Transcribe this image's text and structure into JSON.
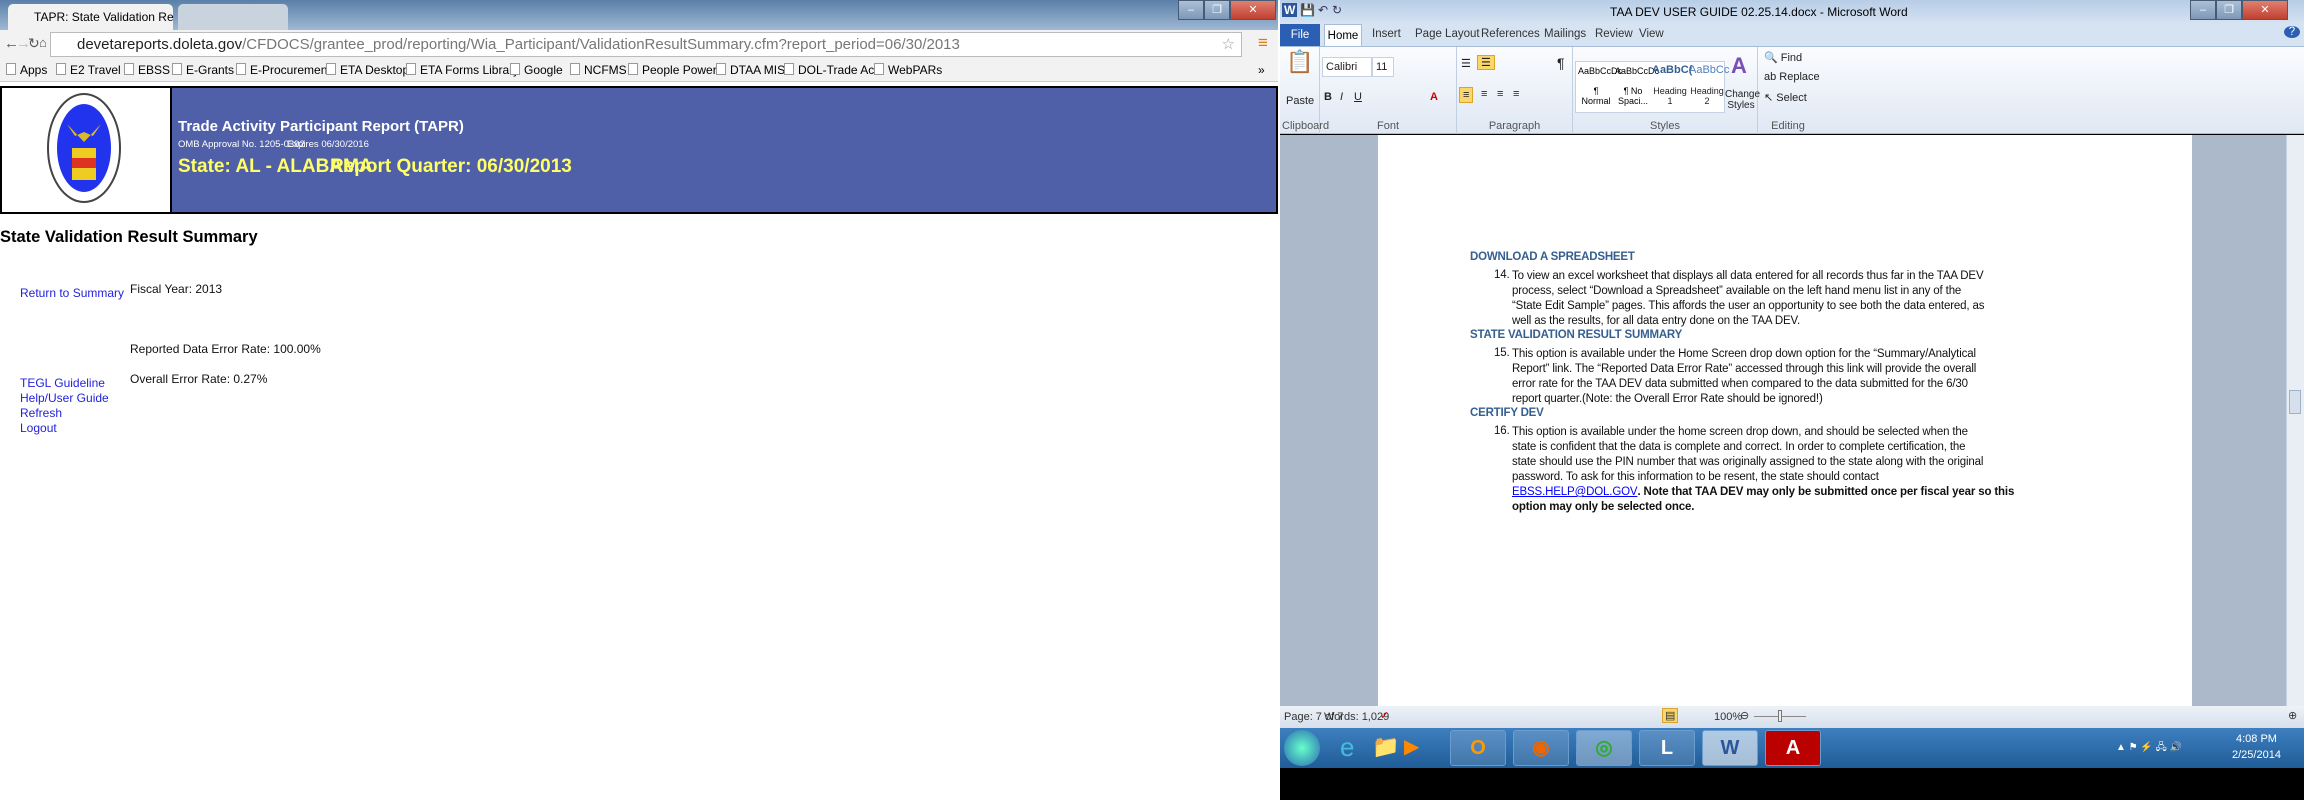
{
  "browser": {
    "tabs": [
      {
        "label": "TAPR: State Validation Res"
      },
      {
        "label": ""
      }
    ],
    "url_host": "devetareports.doleta.gov",
    "url_path": "/CFDOCS/grantee_prod/reporting/Wia_Participant/ValidationResultSummary.cfm?report_period=06/30/2013",
    "bookmarks": [
      "Apps",
      "E2 Travel",
      "EBSS",
      "E-Grants",
      "E-Procurement",
      "ETA Desktop",
      "ETA Forms Library",
      "Google",
      "NCFMS",
      "People Power",
      "DTAA MIS",
      "DOL-Trade Act",
      "WebPARs"
    ],
    "more": "»"
  },
  "page": {
    "title": "Trade Activity Participant Report (TAPR)",
    "omb": "OMB Approval No. 1205-0392",
    "expires": "Expires 06/30/2016",
    "state": "State: AL - ALABAMA",
    "quarter": "Report Quarter: 06/30/2013",
    "heading": "State Validation Result Summary",
    "links": {
      "return": "Return to Summary",
      "tegl": "TEGL Guideline",
      "help": "Help/User Guide",
      "refresh": "Refresh",
      "logout": "Logout"
    },
    "fiscal_year": "Fiscal Year: 2013",
    "reported_rate": "Reported Data Error Rate: 100.00%",
    "overall_rate": "Overall Error Rate: 0.27%"
  },
  "word": {
    "title": "TAA DEV USER GUIDE 02.25.14.docx - Microsoft Word",
    "tabs": [
      "File",
      "Home",
      "Insert",
      "Page Layout",
      "References",
      "Mailings",
      "Review",
      "View"
    ],
    "font": "Calibri",
    "size": "11",
    "paste": "Paste",
    "groups": [
      "Clipboard",
      "Font",
      "Paragraph",
      "Styles",
      "Editing"
    ],
    "styles": [
      {
        "sample": "AaBbCcDc",
        "name": "¶ Normal"
      },
      {
        "sample": "AaBbCcDc",
        "name": "¶ No Spaci..."
      },
      {
        "sample": "AaBbC(",
        "name": "Heading 1"
      },
      {
        "sample": "AaBbCc",
        "name": "Heading 2"
      }
    ],
    "change_styles": "Change Styles",
    "editing": [
      "Find",
      "Replace",
      "Select"
    ],
    "doc": [
      {
        "heading": "DOWNLOAD A SPREADSHEET",
        "num": "14.",
        "lines": [
          "To view an excel worksheet that displays all data entered for all records thus far in the TAA DEV",
          "process, select “Download a Spreadsheet” available on the left hand menu list in any of the",
          "“State Edit Sample” pages.  This affords the user an opportunity to see both the data entered, as",
          "well as the results, for all data entry done on the TAA DEV."
        ]
      },
      {
        "heading": "STATE VALIDATION RESULT SUMMARY",
        "num": "15.",
        "lines": [
          "This option is available under the Home Screen drop down option for the “Summary/Analytical",
          "Report” link. The “Reported Data Error Rate” accessed through this link will provide the overall",
          "error rate for the TAA DEV data submitted when compared to the data submitted for the 6/30",
          "report quarter.(Note: the Overall Error Rate should be ignored!)"
        ]
      },
      {
        "heading": "CERTIFY DEV",
        "num": "16.",
        "lines": [
          "This option is available under the home screen drop down, and should be selected when the",
          "state is confident that the data is complete and correct. In order to complete certification, the",
          "state should use the PIN number that was originally assigned to the state along with the original",
          "password. To ask for this information to be resent, the state should contact"
        ],
        "email": "EBSS.HELP@DOL.GOV",
        "bold1": ". Note that TAA DEV may only be submitted once per fiscal year so this",
        "bold2": "option may only be selected once."
      }
    ],
    "status": {
      "page": "Page: 7 of 7",
      "words": "Words: 1,029",
      "zoom": "100%",
      "zoom_fraction": 0.5
    },
    "clock": {
      "time": "4:08 PM",
      "date": "2/25/2014"
    }
  }
}
